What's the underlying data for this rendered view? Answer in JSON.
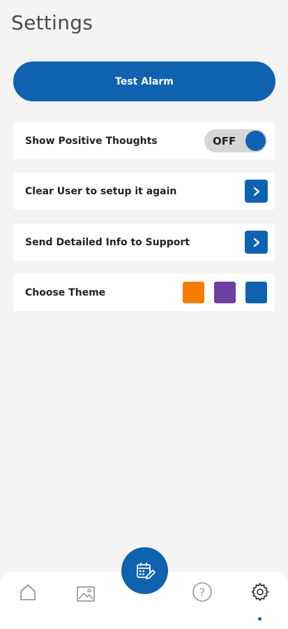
{
  "header": {
    "title": "Settings"
  },
  "actions": {
    "test_alarm_label": "Test Alarm"
  },
  "settings": {
    "positive_thoughts": {
      "label": "Show Positive Thoughts",
      "toggle_state": "OFF"
    },
    "clear_user": {
      "label": "Clear User to setup it again",
      "icon": "chevron-right-icon"
    },
    "send_info": {
      "label": "Send Detailed Info to Support",
      "icon": "chevron-right-icon"
    },
    "theme": {
      "label": "Choose Theme",
      "options": [
        {
          "name": "orange",
          "color": "#f57c00"
        },
        {
          "name": "purple",
          "color": "#6f3ea1"
        },
        {
          "name": "blue",
          "color": "#0f62b0"
        }
      ]
    }
  },
  "bottom_nav": {
    "items": [
      {
        "icon": "home-icon"
      },
      {
        "icon": "image-icon"
      },
      {
        "icon": "calendar-edit-icon"
      },
      {
        "icon": "help-icon"
      },
      {
        "icon": "gear-icon",
        "active": true
      }
    ]
  },
  "colors": {
    "accent": "#0f62b0",
    "background": "#f4f4f4",
    "card": "#ffffff"
  }
}
